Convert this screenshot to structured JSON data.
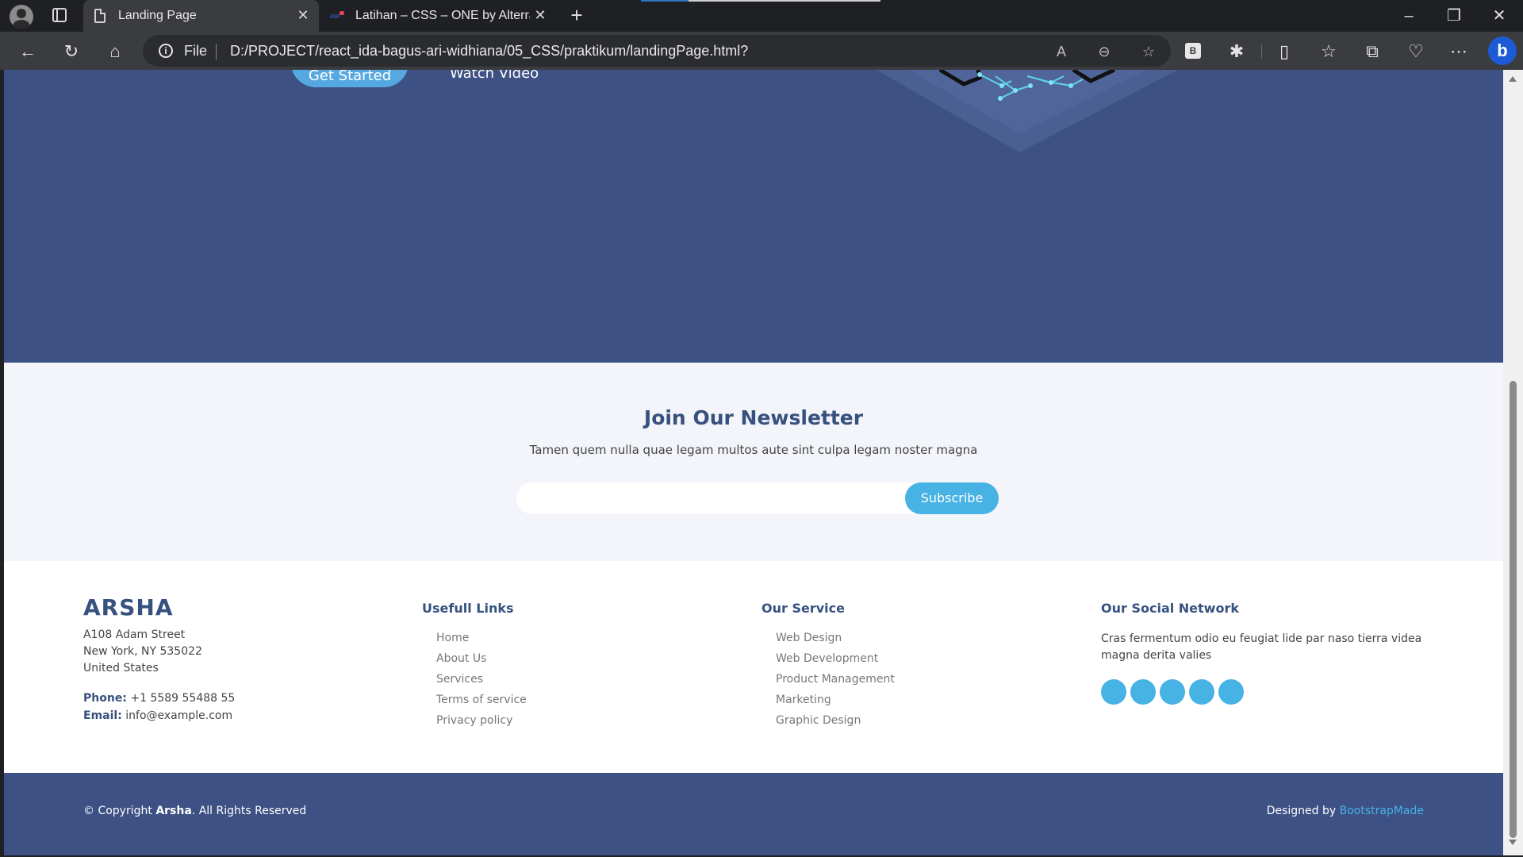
{
  "browser": {
    "tabs": [
      {
        "title": "Landing Page",
        "active": true,
        "icon": "document-icon"
      },
      {
        "title": "Latihan – CSS – ONE by Alterra Academy",
        "active": false,
        "icon": "alterra-favicon"
      }
    ],
    "address_bar": {
      "scheme": "File",
      "url": "D:/PROJECT/react_ida-bagus-ari-widhiana/05_CSS/praktikum/landingPage.html?"
    },
    "extension_label": "B"
  },
  "hero": {
    "get_started_label": "Get Started",
    "watch_video_label": "Watch Video"
  },
  "newsletter": {
    "title": "Join Our Newsletter",
    "subtitle": "Tamen quem nulla quae legam multos aute sint culpa legam noster magna",
    "input_value": "",
    "subscribe_label": "Subscribe"
  },
  "footer": {
    "brand": "ARSHA",
    "address": [
      "A108 Adam Street",
      "New York, NY 535022",
      "United States"
    ],
    "phone_label": "Phone:",
    "phone": "+1 5589 55488 55",
    "email_label": "Email:",
    "email": "info@example.com",
    "useful_links": {
      "title": "Usefull Links",
      "items": [
        "Home",
        "About Us",
        "Services",
        "Terms of service",
        "Privacy policy"
      ]
    },
    "services": {
      "title": "Our Service",
      "items": [
        "Web Design",
        "Web Development",
        "Product Management",
        "Marketing",
        "Graphic Design"
      ]
    },
    "social": {
      "title": "Our Social Network",
      "text": "Cras fermentum odio eu feugiat lide par naso tierra videa magna derita valies",
      "icons": [
        "twitter-icon",
        "facebook-icon",
        "instagram-icon",
        "skype-icon",
        "linkedin-icon"
      ]
    },
    "copyright_prefix": "© Copyright",
    "copyright_brand": "Arsha",
    "copyright_suffix": ". All Rights Reserved",
    "designed_by_label": "Designed by",
    "designed_by_link": "BootstrapMade"
  },
  "colors": {
    "primary": "#37517e",
    "hero_bg": "#3d5184",
    "accent": "#47b2e4",
    "newsletter_bg": "#f3f5fa"
  }
}
